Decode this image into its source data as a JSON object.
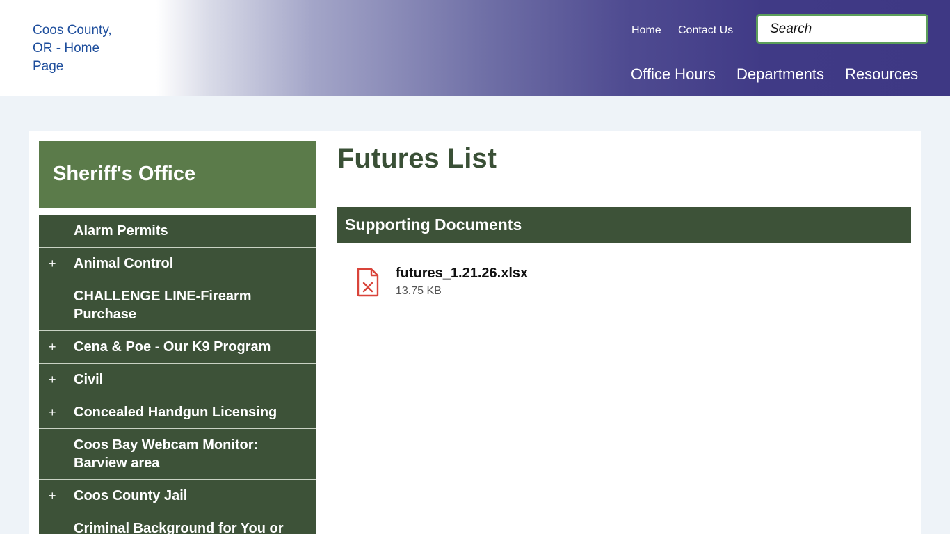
{
  "header": {
    "logo_alt": "Coos County, OR - Home Page",
    "utility_links": [
      "Home",
      "Contact Us"
    ],
    "search_placeholder": "Search",
    "main_nav": [
      "Office Hours",
      "Departments",
      "Resources"
    ]
  },
  "sidebar": {
    "title": "Sheriff's Office",
    "items": [
      {
        "label": "Alarm Permits",
        "expandable": false
      },
      {
        "label": "Animal Control",
        "expandable": true
      },
      {
        "label": "CHALLENGE LINE-Firearm Purchase",
        "expandable": false
      },
      {
        "label": "Cena & Poe - Our K9 Program",
        "expandable": true
      },
      {
        "label": "Civil",
        "expandable": true
      },
      {
        "label": "Concealed Handgun Licensing",
        "expandable": true
      },
      {
        "label": "Coos Bay Webcam Monitor: Barview area",
        "expandable": false
      },
      {
        "label": "Coos County Jail",
        "expandable": true
      },
      {
        "label": "Criminal Background for You or",
        "expandable": false
      }
    ],
    "expand_symbol": "+"
  },
  "main": {
    "title": "Futures List",
    "section_title": "Supporting Documents",
    "documents": [
      {
        "name": "futures_1.21.26.xlsx",
        "size": "13.75 KB",
        "icon": "excel-file-icon"
      }
    ]
  },
  "colors": {
    "header_purple": "#3e3884",
    "sidebar_title_green": "#5b7b4a",
    "dark_green": "#3d5238",
    "search_border": "#5c9e5a",
    "file_icon_red": "#d9443a"
  }
}
